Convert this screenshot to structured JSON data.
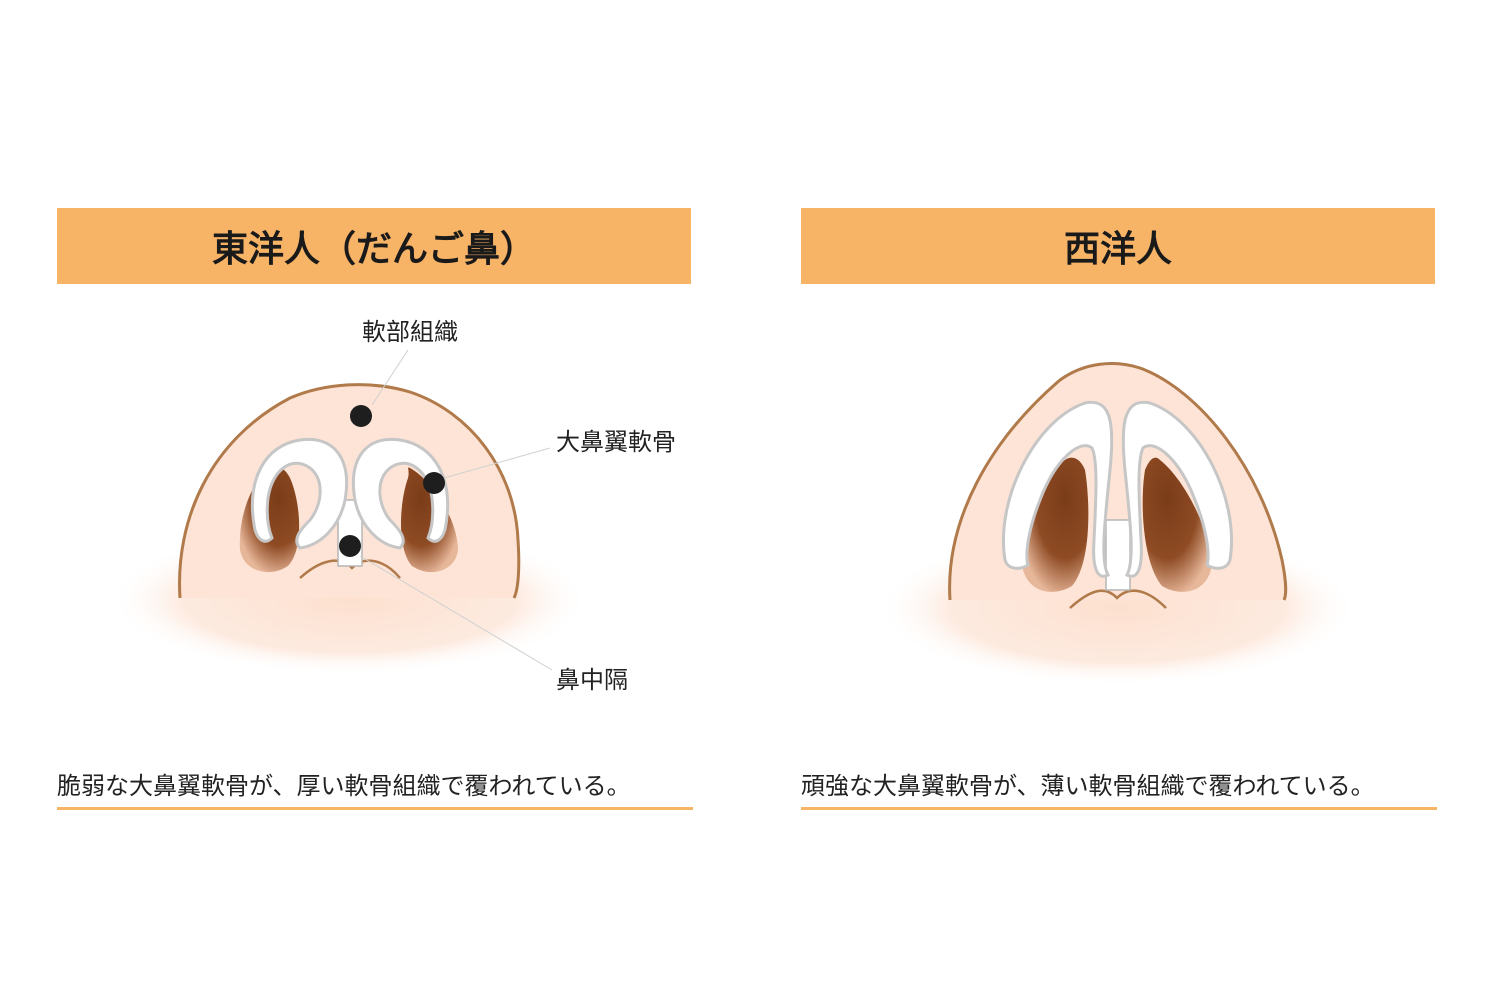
{
  "left_panel": {
    "title": "東洋人（だんご鼻）",
    "labels": {
      "soft_tissue": "軟部組織",
      "alar_cartilage": "大鼻翼軟骨",
      "septum": "鼻中隔"
    },
    "caption": "脆弱な大鼻翼軟骨が、厚い軟骨組織で覆われている。"
  },
  "right_panel": {
    "title": "西洋人",
    "caption": "頑強な大鼻翼軟骨が、薄い軟骨組織で覆われている。"
  },
  "colors": {
    "header_bg": "#f8b466",
    "skin": "#fde4d6",
    "skin_outline": "#b07a4a",
    "nostril": "#8a4a24",
    "cartilage": "#ffffff",
    "marker": "#1e1e1e"
  }
}
